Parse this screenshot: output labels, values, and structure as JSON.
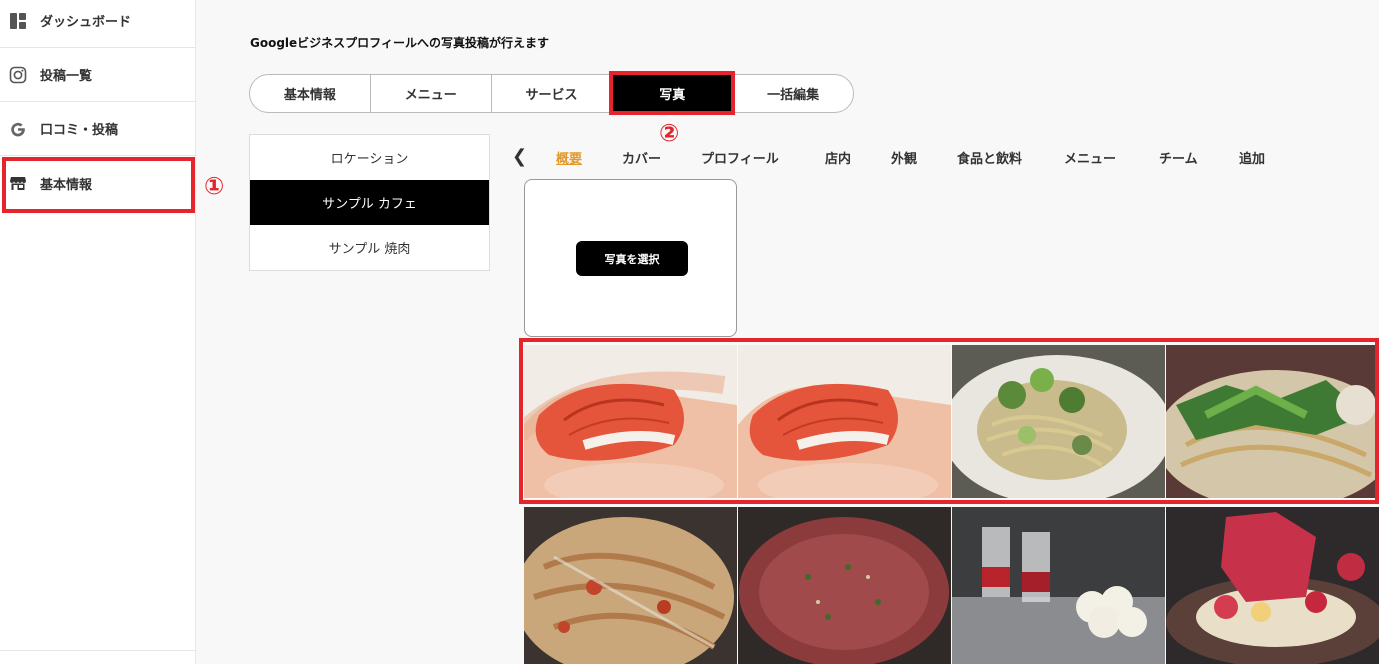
{
  "sidebar": {
    "items": [
      {
        "label": "ダッシュボード",
        "icon": "dashboard-icon"
      },
      {
        "label": "投稿一覧",
        "icon": "instagram-icon"
      },
      {
        "label": "口コミ・投稿",
        "icon": "google-icon"
      },
      {
        "label": "基本情報",
        "icon": "store-icon"
      }
    ]
  },
  "annotations": {
    "one": "①",
    "two": "②"
  },
  "main": {
    "title": "Googleビジネスプロフィールへの写真投稿が行えます",
    "tabs": [
      "基本情報",
      "メニュー",
      "サービス",
      "写真",
      "一括編集"
    ],
    "active_tab": "写真",
    "locations": [
      "ロケーション",
      "サンプル カフェ",
      "サンプル 焼肉"
    ],
    "selected_location": "サンプル カフェ",
    "categories": [
      "概要",
      "カバー",
      "プロフィール",
      "店内",
      "外観",
      "食品と飲料",
      "メニュー",
      "チーム",
      "追加"
    ],
    "active_category": "概要",
    "arrow_left": "❮",
    "select_photo_label": "写真を選択"
  },
  "photos": [
    {
      "subject": "maguro-sushi-in-hand"
    },
    {
      "subject": "maguro-sushi-in-hand"
    },
    {
      "subject": "pasta-with-greens"
    },
    {
      "subject": "pasta-with-greens-closeup"
    },
    {
      "subject": "pasta-with-cheese"
    },
    {
      "subject": "beef-tartare"
    },
    {
      "subject": "dessert-glasses"
    },
    {
      "subject": "strawberry-dessert"
    }
  ],
  "colors": {
    "accent": "#e2982a",
    "annotation": "#e4252b",
    "active_tab": "#000000"
  }
}
